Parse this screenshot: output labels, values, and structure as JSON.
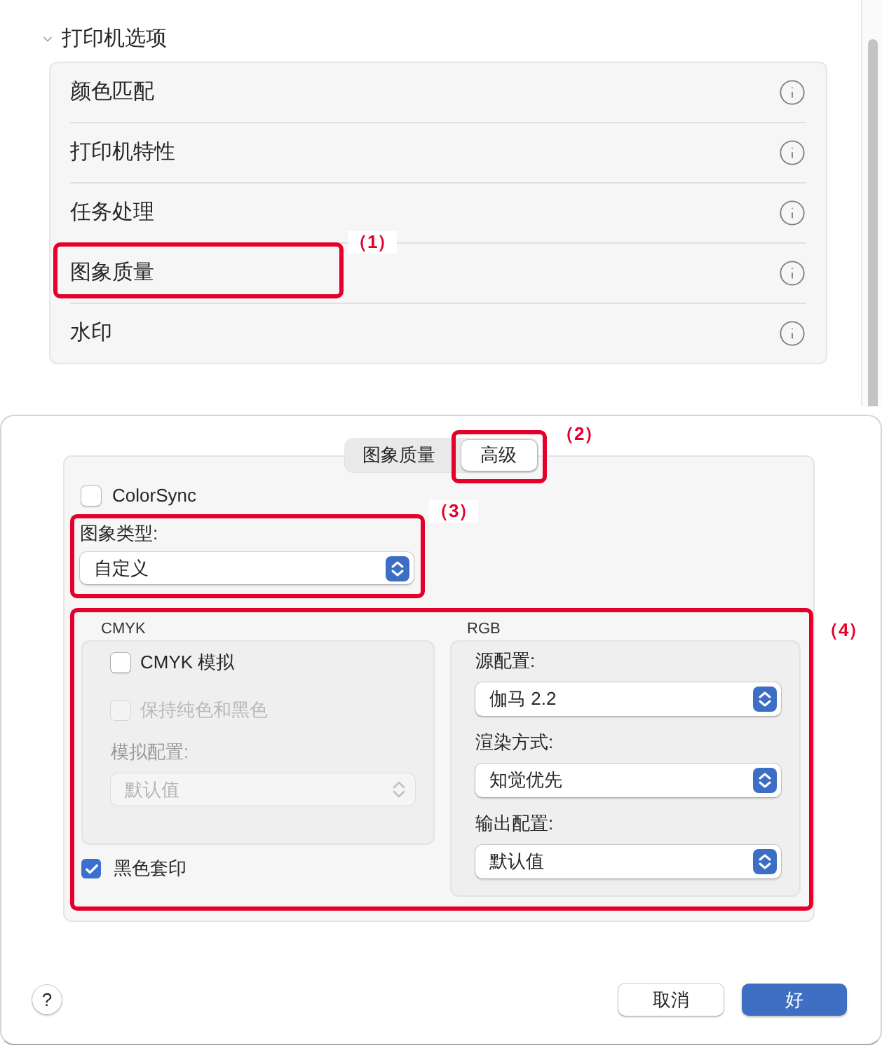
{
  "printer_options": {
    "title": "打印机选项",
    "expanded": true,
    "items": [
      {
        "label": "颜色匹配"
      },
      {
        "label": "打印机特性"
      },
      {
        "label": "任务处理"
      },
      {
        "label": "图象质量",
        "callout": "（1）"
      },
      {
        "label": "水印"
      }
    ]
  },
  "dialog": {
    "tabs": [
      {
        "label": "图象质量",
        "selected": false
      },
      {
        "label": "高级",
        "selected": true,
        "callout": "（2）"
      }
    ],
    "colorsync": {
      "label": "ColorSync",
      "checked": false
    },
    "image_type": {
      "label": "图象类型:",
      "value": "自定义",
      "callout": "（3）"
    },
    "color_settings": {
      "callout": "（4）",
      "cmyk": {
        "title": "CMYK",
        "options": [
          {
            "label": "CMYK 模拟",
            "checked": false,
            "disabled": false
          },
          {
            "label": "保持纯色和黑色",
            "checked": false,
            "disabled": true
          }
        ],
        "profile": {
          "label": "模拟配置:",
          "value": "默认值",
          "disabled": true
        }
      },
      "black_overprint": {
        "label": "黑色套印",
        "checked": true
      },
      "rgb": {
        "title": "RGB",
        "fields": [
          {
            "label": "源配置:",
            "value": "伽马 2.2"
          },
          {
            "label": "渲染方式:",
            "value": "知觉优先"
          },
          {
            "label": "输出配置:",
            "value": "默认值"
          }
        ]
      }
    },
    "help": {
      "label": "?"
    },
    "buttons": [
      {
        "label": "取消",
        "kind": "cancel"
      },
      {
        "label": "好",
        "kind": "default"
      }
    ]
  }
}
